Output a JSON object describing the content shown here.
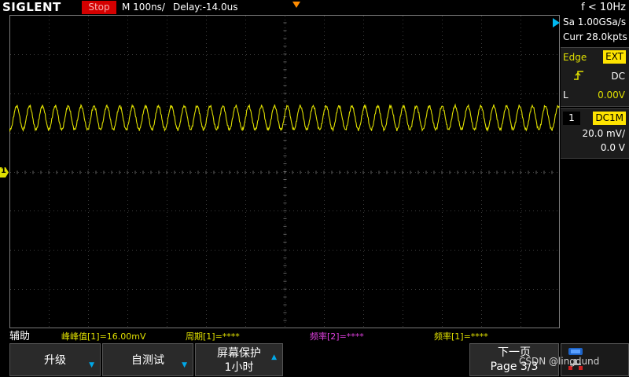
{
  "topbar": {
    "logo": "SIGLENT",
    "run_state": "Stop",
    "timebase": "M 100ns/",
    "delay": "Delay:-14.0us",
    "trigger_freq": "f < 10Hz"
  },
  "acquisition": {
    "sample_rate": "Sa 1.00GSa/s",
    "memory": "Curr 28.0kpts"
  },
  "trigger": {
    "type": "Edge",
    "source": "EXT",
    "coupling": "DC",
    "level_label": "L",
    "level": "0.00V"
  },
  "channel1": {
    "number": "1",
    "coupling": "DC1M",
    "scale": "20.0 mV/",
    "offset": "0.0 V",
    "marker": "1"
  },
  "measurements": {
    "title": "辅助",
    "items": [
      {
        "text": "峰峰值[1]=16.00mV"
      },
      {
        "text": "周期[1]=****"
      },
      {
        "text": "频率[2]=****"
      },
      {
        "text": "频率[1]=****"
      }
    ]
  },
  "softkeys": {
    "upgrade": "升级",
    "selftest": "自测试",
    "screensaver_l1": "屏幕保护",
    "screensaver_l2": "1小时",
    "next_l1": "下一页",
    "next_l2": "Page 3/3"
  },
  "watermark": "CSDN @lingdund",
  "colors": {
    "ch1": "#e0e000",
    "accent": "#00a8e8",
    "stop": "#d40000",
    "trigger_marker": "#ff8c00"
  }
}
